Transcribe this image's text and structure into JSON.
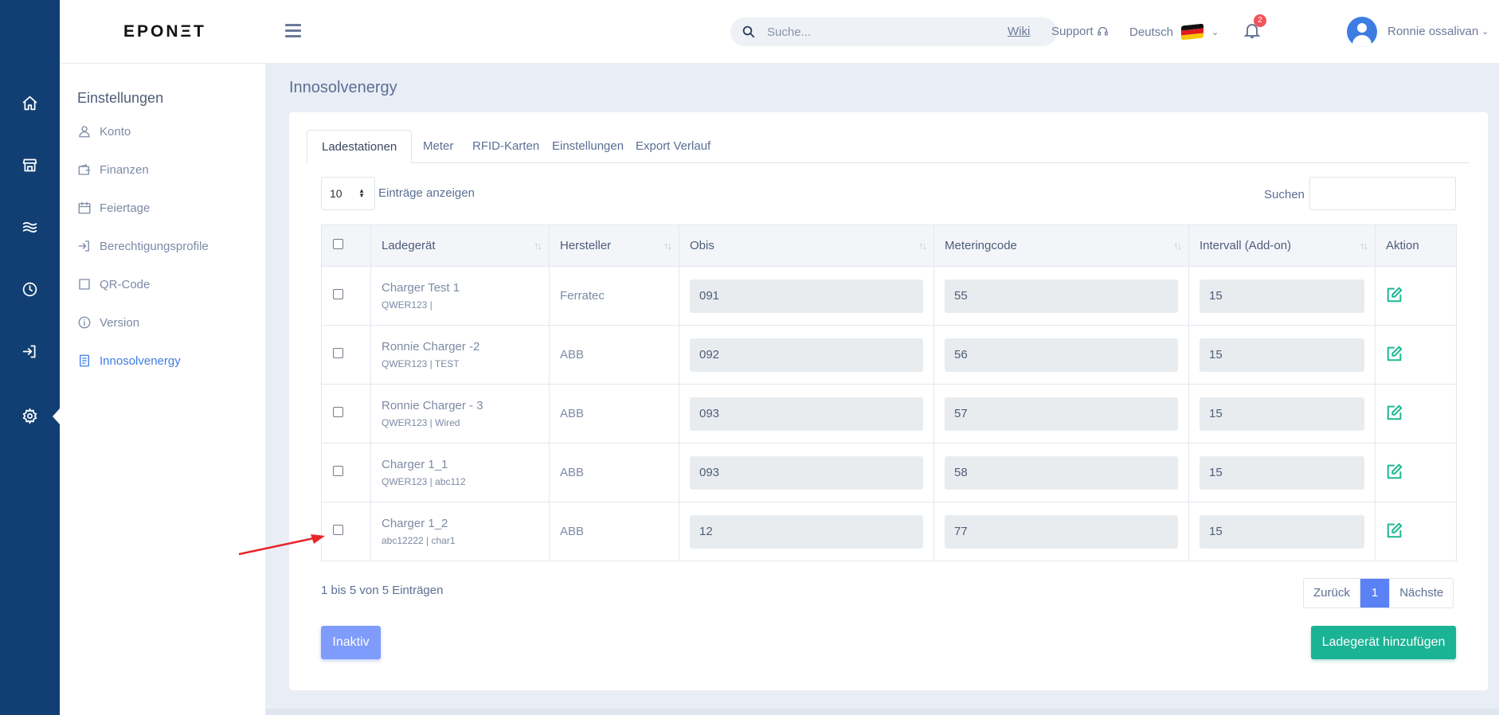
{
  "rail": {
    "items": [
      {
        "name": "home-icon"
      },
      {
        "name": "store-icon"
      },
      {
        "name": "waves-icon"
      },
      {
        "name": "clock-icon"
      },
      {
        "name": "login-icon"
      },
      {
        "name": "gear-icon",
        "active": true
      }
    ]
  },
  "topbar": {
    "logo": "EPONΞT",
    "search_placeholder": "Suche...",
    "wiki": "Wiki",
    "support": "Support",
    "language": "Deutsch",
    "notification_count": "2",
    "user_name": "Ronnie ossalivan"
  },
  "settings": {
    "title": "Einstellungen",
    "items": [
      {
        "label": "Konto",
        "icon": "user-icon"
      },
      {
        "label": "Finanzen",
        "icon": "wallet-icon"
      },
      {
        "label": "Feiertage",
        "icon": "calendar-icon"
      },
      {
        "label": "Berechtigungsprofile",
        "icon": "login-icon"
      },
      {
        "label": "QR-Code",
        "icon": "square-icon"
      },
      {
        "label": "Version",
        "icon": "info-icon"
      },
      {
        "label": "Innosolvenergy",
        "icon": "document-icon",
        "active": true
      }
    ]
  },
  "main": {
    "page_title": "Innosolvenergy",
    "tabs": [
      "Ladestationen",
      "Meter",
      "RFID-Karten",
      "Einstellungen",
      "Export Verlauf"
    ],
    "active_tab": "Ladestationen",
    "length_value": "10",
    "length_label": "Einträge anzeigen",
    "search_label": "Suchen",
    "columns": [
      "Ladegerät",
      "Hersteller",
      "Obis",
      "Meteringcode",
      "Intervall (Add-on)",
      "Aktion"
    ],
    "rows": [
      {
        "name": "Charger Test 1",
        "sub": "QWER123 |",
        "manufacturer": "Ferratec",
        "obis": "091",
        "metering": "55",
        "interval": "15"
      },
      {
        "name": "Ronnie Charger -2",
        "sub": "QWER123 | TEST",
        "manufacturer": "ABB",
        "obis": "092",
        "metering": "56",
        "interval": "15"
      },
      {
        "name": "Ronnie Charger - 3",
        "sub": "QWER123 | Wired",
        "manufacturer": "ABB",
        "obis": "093",
        "metering": "57",
        "interval": "15"
      },
      {
        "name": "Charger 1_1",
        "sub": "QWER123 | abc112",
        "manufacturer": "ABB",
        "obis": "093",
        "metering": "58",
        "interval": "15"
      },
      {
        "name": "Charger 1_2",
        "sub": "abc12222 | char1",
        "manufacturer": "ABB",
        "obis": "12",
        "metering": "77",
        "interval": "15"
      }
    ],
    "info": "1 bis 5 von 5 Einträgen",
    "pager": {
      "prev": "Zurück",
      "current": "1",
      "next": "Nächste"
    },
    "inactive_button": "Inaktiv",
    "add_button": "Ladegerät hinzufügen"
  },
  "colors": {
    "rail": "#123f73",
    "accent": "#3d7de3",
    "success": "#1ab394",
    "annotation_arrow": "#e8262a"
  }
}
